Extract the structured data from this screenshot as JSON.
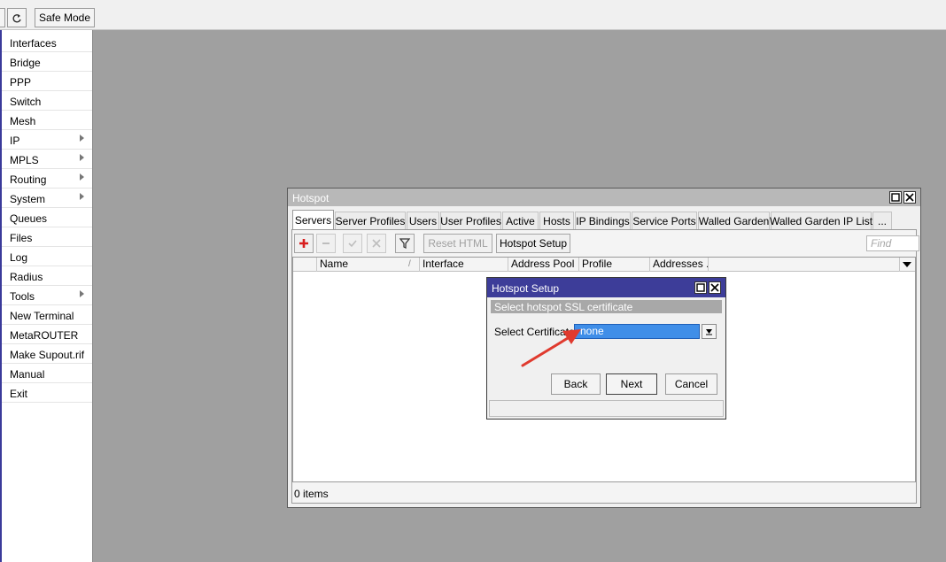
{
  "toolbar": {
    "safe_mode_label": "Safe Mode",
    "redo_icon": "redo-icon"
  },
  "sidebar": {
    "items": [
      {
        "label": "Interfaces",
        "submenu": false
      },
      {
        "label": "Bridge",
        "submenu": false
      },
      {
        "label": "PPP",
        "submenu": false
      },
      {
        "label": "Switch",
        "submenu": false
      },
      {
        "label": "Mesh",
        "submenu": false
      },
      {
        "label": "IP",
        "submenu": true
      },
      {
        "label": "MPLS",
        "submenu": true
      },
      {
        "label": "Routing",
        "submenu": true
      },
      {
        "label": "System",
        "submenu": true
      },
      {
        "label": "Queues",
        "submenu": false
      },
      {
        "label": "Files",
        "submenu": false
      },
      {
        "label": "Log",
        "submenu": false
      },
      {
        "label": "Radius",
        "submenu": false
      },
      {
        "label": "Tools",
        "submenu": true
      },
      {
        "label": "New Terminal",
        "submenu": false
      },
      {
        "label": "MetaROUTER",
        "submenu": false
      },
      {
        "label": "Make Supout.rif",
        "submenu": false
      },
      {
        "label": "Manual",
        "submenu": false
      },
      {
        "label": "Exit",
        "submenu": false
      }
    ]
  },
  "hotspot": {
    "title": "Hotspot",
    "tabs": [
      "Servers",
      "Server Profiles",
      "Users",
      "User Profiles",
      "Active",
      "Hosts",
      "IP Bindings",
      "Service Ports",
      "Walled Garden",
      "Walled Garden IP List",
      "..."
    ],
    "active_tab": "Servers",
    "toolbar": {
      "reset_html_label": "Reset HTML",
      "hotspot_setup_label": "Hotspot Setup",
      "find_placeholder": "Find"
    },
    "columns": [
      "Name",
      "Interface",
      "Address Pool",
      "Profile",
      "Addresses ..."
    ],
    "status": "0 items"
  },
  "setup_dialog": {
    "title": "Hotspot Setup",
    "banner": "Select hotspot SSL certificate",
    "cert_label": "Select Certificate:",
    "cert_value": "none",
    "back_label": "Back",
    "next_label": "Next",
    "cancel_label": "Cancel"
  },
  "colors": {
    "dialog_title": "#3d3d99",
    "selection": "#3f8ee8",
    "arrow": "#e03a2e",
    "desktop": "#a0a0a0"
  }
}
